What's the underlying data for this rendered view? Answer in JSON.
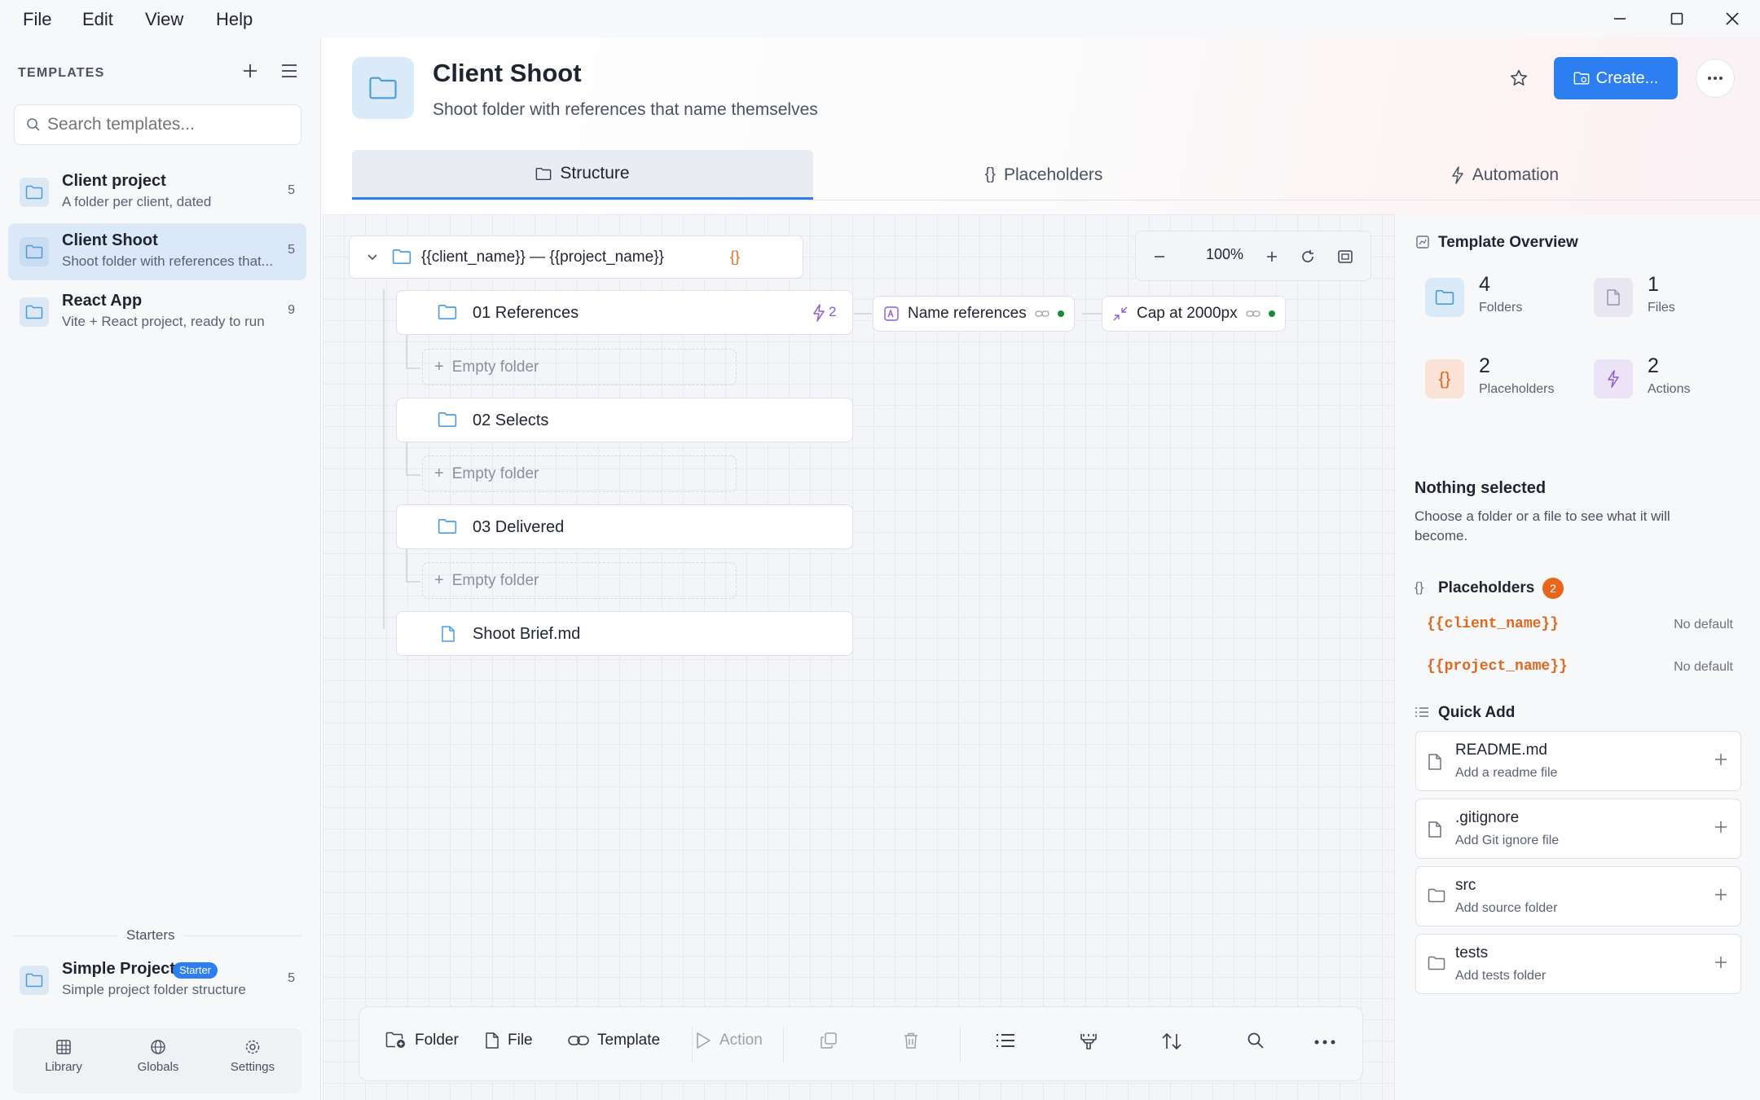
{
  "menubar": {
    "items": [
      "File",
      "Edit",
      "View",
      "Help"
    ]
  },
  "sidebar": {
    "section_title": "TEMPLATES",
    "search_placeholder": "Search templates...",
    "templates": [
      {
        "name": "Client project",
        "desc": "A folder per client, dated",
        "count": "5"
      },
      {
        "name": "Client Shoot",
        "desc": "Shoot folder with references that...",
        "count": "5"
      },
      {
        "name": "React App",
        "desc": "Vite + React project, ready to run",
        "count": "9"
      }
    ],
    "starters_title": "Starters",
    "starter": {
      "name": "Simple Project",
      "badge": "Starter",
      "desc": "Simple project folder structure",
      "count": "5"
    },
    "bottom_nav": [
      "Library",
      "Globals",
      "Settings"
    ]
  },
  "header": {
    "title": "Client Shoot",
    "subtitle": "Shoot folder with references that name themselves",
    "create_label": "Create..."
  },
  "tabs": [
    "Structure",
    "Placeholders",
    "Automation"
  ],
  "canvas": {
    "root": "{{client_name}} — {{project_name}}",
    "root_badge": "{}",
    "zoom": "100%",
    "nodes": [
      {
        "label": "01 References",
        "actions": "2"
      },
      {
        "label": "02 Selects"
      },
      {
        "label": "03 Delivered"
      },
      {
        "label": "Shoot Brief.md"
      }
    ],
    "empty_label": "Empty folder",
    "chips": [
      "Name references",
      "Cap at 2000px"
    ]
  },
  "toolbar": {
    "folder": "Folder",
    "file": "File",
    "template": "Template",
    "action": "Action"
  },
  "overview": {
    "title": "Template Overview",
    "stats": [
      {
        "num": "4",
        "label": "Folders"
      },
      {
        "num": "1",
        "label": "Files"
      },
      {
        "num": "2",
        "label": "Placeholders"
      },
      {
        "num": "2",
        "label": "Actions"
      }
    ],
    "nothing_title": "Nothing selected",
    "nothing_desc": "Choose a folder or a file to see what it will become.",
    "placeholders_title": "Placeholders",
    "placeholders_count": "2",
    "placeholders": [
      {
        "name": "{{client_name}}",
        "default": "No default"
      },
      {
        "name": "{{project_name}}",
        "default": "No default"
      }
    ],
    "quick_add_title": "Quick Add",
    "quick_add": [
      {
        "name": "README.md",
        "desc": "Add a readme file"
      },
      {
        "name": ".gitignore",
        "desc": "Add Git ignore file"
      },
      {
        "name": "src",
        "desc": "Add source folder"
      },
      {
        "name": "tests",
        "desc": "Add tests folder"
      }
    ]
  },
  "colors": {
    "accent": "#2d7ef0",
    "placeholder": "#e0671c",
    "active_dot": "#1a8a3a"
  }
}
